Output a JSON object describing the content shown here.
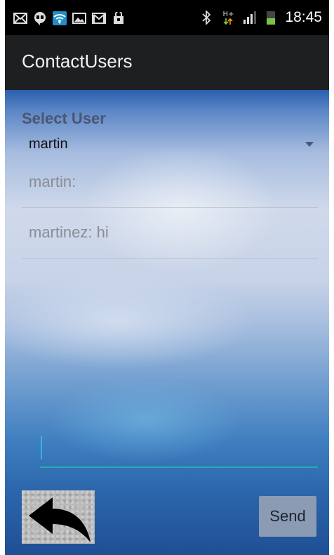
{
  "status_bar": {
    "time": "18:45",
    "icons": [
      "mail-icon",
      "hangouts-icon",
      "wifi-icon",
      "gallery-icon",
      "gmail-icon",
      "shopping-bag-icon",
      "bluetooth-icon",
      "data-transfer-icon",
      "signal-icon",
      "battery-icon"
    ],
    "data_label": "H+"
  },
  "action_bar": {
    "title": "ContactUsers"
  },
  "select_user": {
    "label": "Select User",
    "selected": "martin"
  },
  "messages": [
    "martin:",
    "martinez: hi"
  ],
  "compose": {
    "value": ""
  },
  "buttons": {
    "send": "Send"
  },
  "colors": {
    "accent": "#20b0a8",
    "cursor": "#33b5e5",
    "send_bg": "#8a9bb3",
    "action_bar_bg": "#1e1f21"
  }
}
